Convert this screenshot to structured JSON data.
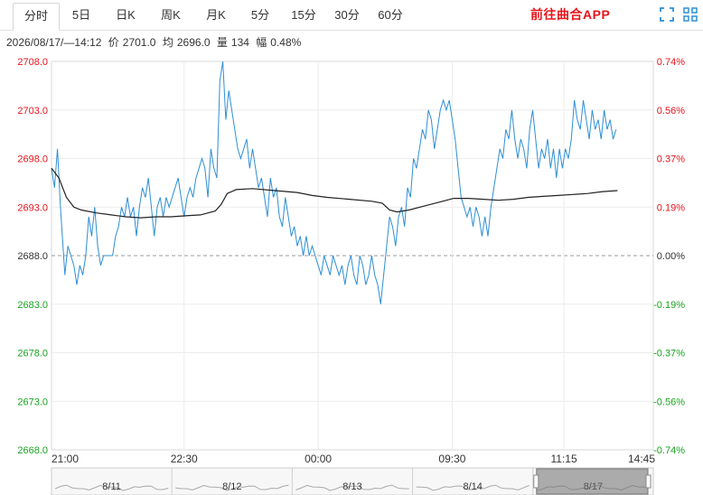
{
  "tabs": [
    {
      "label": "分时",
      "active": true
    },
    {
      "label": "5日",
      "active": false
    },
    {
      "label": "日K",
      "active": false
    },
    {
      "label": "周K",
      "active": false
    },
    {
      "label": "月K",
      "active": false
    },
    {
      "label": "5分",
      "active": false
    },
    {
      "label": "15分",
      "active": false
    },
    {
      "label": "30分",
      "active": false
    },
    {
      "label": "60分",
      "active": false
    }
  ],
  "promo_text": "前往曲合APP",
  "toolbar": {
    "icons": [
      "expand-icon",
      "grid-icon"
    ]
  },
  "info": {
    "datetime": "2026/08/17/—14:12",
    "price_label": "价",
    "price_value": "2701.0",
    "avg_label": "均",
    "avg_value": "2696.0",
    "vol_label": "量",
    "vol_value": "134",
    "pct_label": "幅",
    "pct_value": "0.48%"
  },
  "colors": {
    "up": "#e8141b",
    "down": "#1aa321",
    "neutral": "#333333",
    "price_line": "#2d8fd5",
    "avg_line": "#222222"
  },
  "chart_data": {
    "type": "line",
    "reference_price": 2688.0,
    "ylim": [
      2668.0,
      2708.0
    ],
    "y_ticks": [
      {
        "value": 2708.0,
        "label": "2708.0",
        "pct": "0.74%"
      },
      {
        "value": 2703.0,
        "label": "2703.0",
        "pct": "0.56%"
      },
      {
        "value": 2698.0,
        "label": "2698.0",
        "pct": "0.37%"
      },
      {
        "value": 2693.0,
        "label": "2693.0",
        "pct": "0.19%"
      },
      {
        "value": 2688.0,
        "label": "2688.0",
        "pct": "0.00%"
      },
      {
        "value": 2683.0,
        "label": "2683.0",
        "pct": "-0.19%"
      },
      {
        "value": 2678.0,
        "label": "2678.0",
        "pct": "-0.37%"
      },
      {
        "value": 2673.0,
        "label": "2673.0",
        "pct": "-0.56%"
      },
      {
        "value": 2668.0,
        "label": "2668.0",
        "pct": "-0.74%"
      }
    ],
    "x_ticks": [
      {
        "i": 0,
        "label": "21:00"
      },
      {
        "i": 89,
        "label": "22:30"
      },
      {
        "i": 179,
        "label": "00:00"
      },
      {
        "i": 269,
        "label": "09:30"
      },
      {
        "i": 344,
        "label": "11:15"
      },
      {
        "i": 404,
        "label": "14:45"
      }
    ],
    "total_points": 404,
    "price_series": {
      "name": "价",
      "points": [
        [
          0,
          2697
        ],
        [
          2,
          2695
        ],
        [
          4,
          2699
        ],
        [
          6,
          2693
        ],
        [
          9,
          2686
        ],
        [
          11,
          2689
        ],
        [
          13,
          2688
        ],
        [
          15,
          2687
        ],
        [
          17,
          2685
        ],
        [
          19,
          2687
        ],
        [
          21,
          2686
        ],
        [
          23,
          2688
        ],
        [
          25,
          2692
        ],
        [
          27,
          2690
        ],
        [
          29,
          2693
        ],
        [
          31,
          2689
        ],
        [
          33,
          2687
        ],
        [
          35,
          2688
        ],
        [
          38,
          2688
        ],
        [
          41,
          2688
        ],
        [
          43,
          2690
        ],
        [
          45,
          2691
        ],
        [
          47,
          2693
        ],
        [
          49,
          2692
        ],
        [
          51,
          2694
        ],
        [
          53,
          2692
        ],
        [
          55,
          2693
        ],
        [
          57,
          2690
        ],
        [
          59,
          2693
        ],
        [
          61,
          2695
        ],
        [
          63,
          2694
        ],
        [
          65,
          2696
        ],
        [
          67,
          2693
        ],
        [
          69,
          2690
        ],
        [
          71,
          2693
        ],
        [
          73,
          2694
        ],
        [
          75,
          2692
        ],
        [
          77,
          2694
        ],
        [
          79,
          2693
        ],
        [
          81,
          2694
        ],
        [
          83,
          2695
        ],
        [
          85,
          2696
        ],
        [
          87,
          2694
        ],
        [
          89,
          2692
        ],
        [
          91,
          2694
        ],
        [
          93,
          2695
        ],
        [
          95,
          2694
        ],
        [
          97,
          2696
        ],
        [
          99,
          2697
        ],
        [
          101,
          2698
        ],
        [
          103,
          2697
        ],
        [
          105,
          2694
        ],
        [
          107,
          2699
        ],
        [
          109,
          2697
        ],
        [
          111,
          2696
        ],
        [
          113,
          2706
        ],
        [
          115,
          2708
        ],
        [
          117,
          2702
        ],
        [
          119,
          2705
        ],
        [
          121,
          2703
        ],
        [
          123,
          2701
        ],
        [
          125,
          2699
        ],
        [
          127,
          2698
        ],
        [
          129,
          2699
        ],
        [
          131,
          2700
        ],
        [
          133,
          2697
        ],
        [
          135,
          2699
        ],
        [
          137,
          2697
        ],
        [
          139,
          2695
        ],
        [
          141,
          2696
        ],
        [
          143,
          2694
        ],
        [
          145,
          2692
        ],
        [
          147,
          2696
        ],
        [
          149,
          2694
        ],
        [
          151,
          2695
        ],
        [
          153,
          2692
        ],
        [
          155,
          2691
        ],
        [
          157,
          2694
        ],
        [
          159,
          2692
        ],
        [
          161,
          2690
        ],
        [
          163,
          2691
        ],
        [
          165,
          2689
        ],
        [
          167,
          2690
        ],
        [
          169,
          2688
        ],
        [
          171,
          2690
        ],
        [
          173,
          2688
        ],
        [
          175,
          2689
        ],
        [
          177,
          2688
        ],
        [
          179,
          2687
        ],
        [
          181,
          2686
        ],
        [
          183,
          2688
        ],
        [
          185,
          2687
        ],
        [
          187,
          2686
        ],
        [
          189,
          2688
        ],
        [
          191,
          2687
        ],
        [
          193,
          2686
        ],
        [
          195,
          2687
        ],
        [
          197,
          2685
        ],
        [
          199,
          2687
        ],
        [
          201,
          2688
        ],
        [
          203,
          2686
        ],
        [
          205,
          2685
        ],
        [
          207,
          2688
        ],
        [
          209,
          2687
        ],
        [
          211,
          2685
        ],
        [
          213,
          2686
        ],
        [
          215,
          2688
        ],
        [
          217,
          2686
        ],
        [
          219,
          2685
        ],
        [
          221,
          2683
        ],
        [
          223,
          2686
        ],
        [
          225,
          2689
        ],
        [
          227,
          2692
        ],
        [
          229,
          2691
        ],
        [
          231,
          2689
        ],
        [
          233,
          2692
        ],
        [
          235,
          2693
        ],
        [
          237,
          2691
        ],
        [
          239,
          2695
        ],
        [
          241,
          2694
        ],
        [
          243,
          2698
        ],
        [
          245,
          2697
        ],
        [
          247,
          2699
        ],
        [
          249,
          2701
        ],
        [
          251,
          2700
        ],
        [
          253,
          2703
        ],
        [
          255,
          2702
        ],
        [
          257,
          2699
        ],
        [
          259,
          2701
        ],
        [
          261,
          2703
        ],
        [
          263,
          2704
        ],
        [
          265,
          2703
        ],
        [
          267,
          2704
        ],
        [
          269,
          2702
        ],
        [
          271,
          2700
        ],
        [
          273,
          2697
        ],
        [
          275,
          2694
        ],
        [
          277,
          2693
        ],
        [
          279,
          2692
        ],
        [
          281,
          2693
        ],
        [
          283,
          2691
        ],
        [
          285,
          2693
        ],
        [
          287,
          2692
        ],
        [
          289,
          2690
        ],
        [
          291,
          2692
        ],
        [
          293,
          2690
        ],
        [
          295,
          2693
        ],
        [
          297,
          2695
        ],
        [
          299,
          2697
        ],
        [
          301,
          2699
        ],
        [
          303,
          2698
        ],
        [
          305,
          2701
        ],
        [
          307,
          2700
        ],
        [
          309,
          2703
        ],
        [
          311,
          2700
        ],
        [
          313,
          2698
        ],
        [
          315,
          2700
        ],
        [
          317,
          2699
        ],
        [
          319,
          2697
        ],
        [
          321,
          2701
        ],
        [
          323,
          2703
        ],
        [
          325,
          2700
        ],
        [
          327,
          2697
        ],
        [
          329,
          2699
        ],
        [
          331,
          2698
        ],
        [
          333,
          2700
        ],
        [
          335,
          2697
        ],
        [
          337,
          2699
        ],
        [
          339,
          2696
        ],
        [
          341,
          2699
        ],
        [
          343,
          2697
        ],
        [
          345,
          2699
        ],
        [
          347,
          2698
        ],
        [
          349,
          2700
        ],
        [
          351,
          2704
        ],
        [
          353,
          2702
        ],
        [
          355,
          2701
        ],
        [
          357,
          2704
        ],
        [
          359,
          2702
        ],
        [
          361,
          2700
        ],
        [
          363,
          2703
        ],
        [
          365,
          2701
        ],
        [
          367,
          2702
        ],
        [
          369,
          2700
        ],
        [
          371,
          2703
        ],
        [
          373,
          2701
        ],
        [
          375,
          2702
        ],
        [
          377,
          2700
        ],
        [
          379,
          2701
        ]
      ]
    },
    "avg_series": {
      "name": "均",
      "points": [
        [
          0,
          2697
        ],
        [
          5,
          2696
        ],
        [
          10,
          2694
        ],
        [
          15,
          2693
        ],
        [
          20,
          2692.7
        ],
        [
          30,
          2692.4
        ],
        [
          40,
          2692.2
        ],
        [
          50,
          2692.0
        ],
        [
          60,
          2691.9
        ],
        [
          70,
          2692.0
        ],
        [
          80,
          2692.0
        ],
        [
          90,
          2692.1
        ],
        [
          100,
          2692.2
        ],
        [
          110,
          2692.6
        ],
        [
          114,
          2693.3
        ],
        [
          118,
          2694.4
        ],
        [
          124,
          2694.8
        ],
        [
          135,
          2694.9
        ],
        [
          150,
          2694.7
        ],
        [
          165,
          2694.5
        ],
        [
          175,
          2694.2
        ],
        [
          185,
          2694.0
        ],
        [
          200,
          2693.8
        ],
        [
          215,
          2693.6
        ],
        [
          222,
          2693.4
        ],
        [
          227,
          2692.7
        ],
        [
          232,
          2692.5
        ],
        [
          240,
          2692.7
        ],
        [
          250,
          2693.1
        ],
        [
          260,
          2693.5
        ],
        [
          270,
          2693.9
        ],
        [
          280,
          2693.9
        ],
        [
          290,
          2693.8
        ],
        [
          300,
          2693.7
        ],
        [
          310,
          2693.8
        ],
        [
          320,
          2694.0
        ],
        [
          330,
          2694.1
        ],
        [
          340,
          2694.2
        ],
        [
          350,
          2694.3
        ],
        [
          360,
          2694.4
        ],
        [
          370,
          2694.6
        ],
        [
          380,
          2694.7
        ]
      ]
    },
    "navigator": {
      "labels": [
        "8/11",
        "8/12",
        "8/13",
        "8/14",
        "8/17"
      ]
    }
  }
}
